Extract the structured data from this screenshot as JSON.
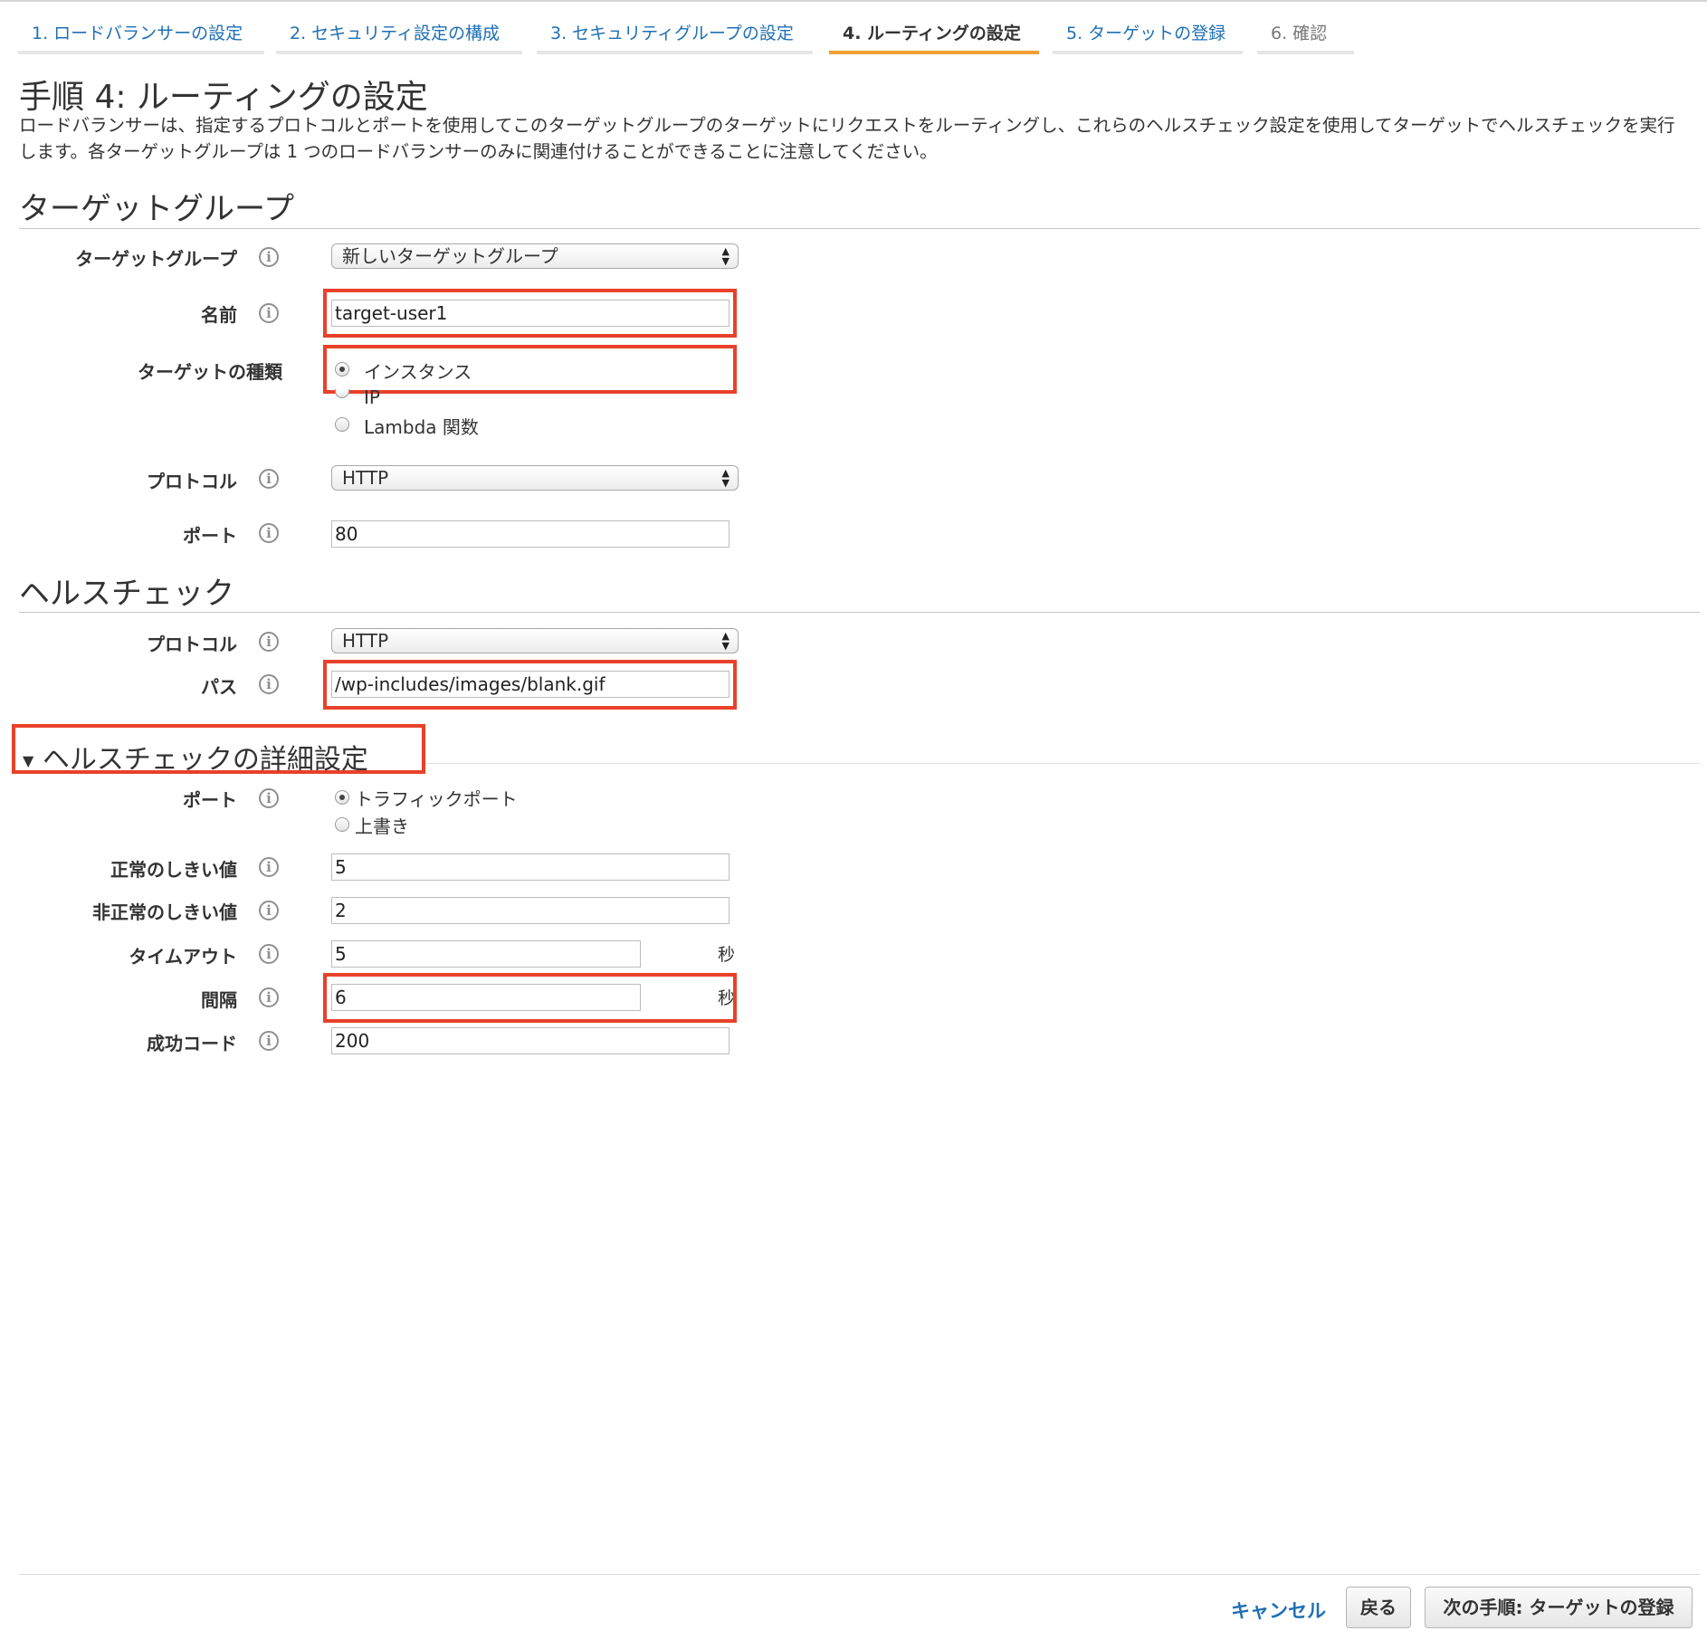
{
  "tabs": [
    {
      "label": "1. ロードバランサーの設定"
    },
    {
      "label": "2. セキュリティ設定の構成"
    },
    {
      "label": "3. セキュリティグループの設定"
    },
    {
      "label": "4. ルーティングの設定"
    },
    {
      "label": "5. ターゲットの登録"
    },
    {
      "label": "6. 確認"
    }
  ],
  "page": {
    "title": "手順 4: ルーティングの設定",
    "description": "ロードバランサーは、指定するプロトコルとポートを使用してこのターゲットグループのターゲットにリクエストをルーティングし、これらのヘルスチェック設定を使用してターゲットでヘルスチェックを実行します。各ターゲットグループは 1 つのロードバランサーのみに関連付けることができることに注意してください。"
  },
  "target_group": {
    "section_title": "ターゲットグループ",
    "group_label": "ターゲットグループ",
    "group_value": "新しいターゲットグループ",
    "name_label": "名前",
    "name_value": "target-user1",
    "type_label": "ターゲットの種類",
    "type_options": [
      "インスタンス",
      "IP",
      "Lambda 関数"
    ],
    "protocol_label": "プロトコル",
    "protocol_value": "HTTP",
    "port_label": "ポート",
    "port_value": "80"
  },
  "health_check": {
    "section_title": "ヘルスチェック",
    "protocol_label": "プロトコル",
    "protocol_value": "HTTP",
    "path_label": "パス",
    "path_value": "/wp-includes/images/blank.gif"
  },
  "advanced": {
    "section_title": "ヘルスチェックの詳細設定",
    "port_label": "ポート",
    "port_options": [
      "トラフィックポート",
      "上書き"
    ],
    "healthy_label": "正常のしきい値",
    "healthy_value": "5",
    "unhealthy_label": "非正常のしきい値",
    "unhealthy_value": "2",
    "timeout_label": "タイムアウト",
    "timeout_value": "5",
    "timeout_unit": "秒",
    "interval_label": "間隔",
    "interval_value": "6",
    "interval_unit": "秒",
    "success_label": "成功コード",
    "success_value": "200"
  },
  "footer": {
    "cancel": "キャンセル",
    "back": "戻る",
    "next": "次の手順: ターゲットの登録"
  },
  "info_glyph": "i",
  "colors": {
    "accent": "#f0a032",
    "link": "#1f6fb5",
    "highlight": "#e8412a"
  }
}
